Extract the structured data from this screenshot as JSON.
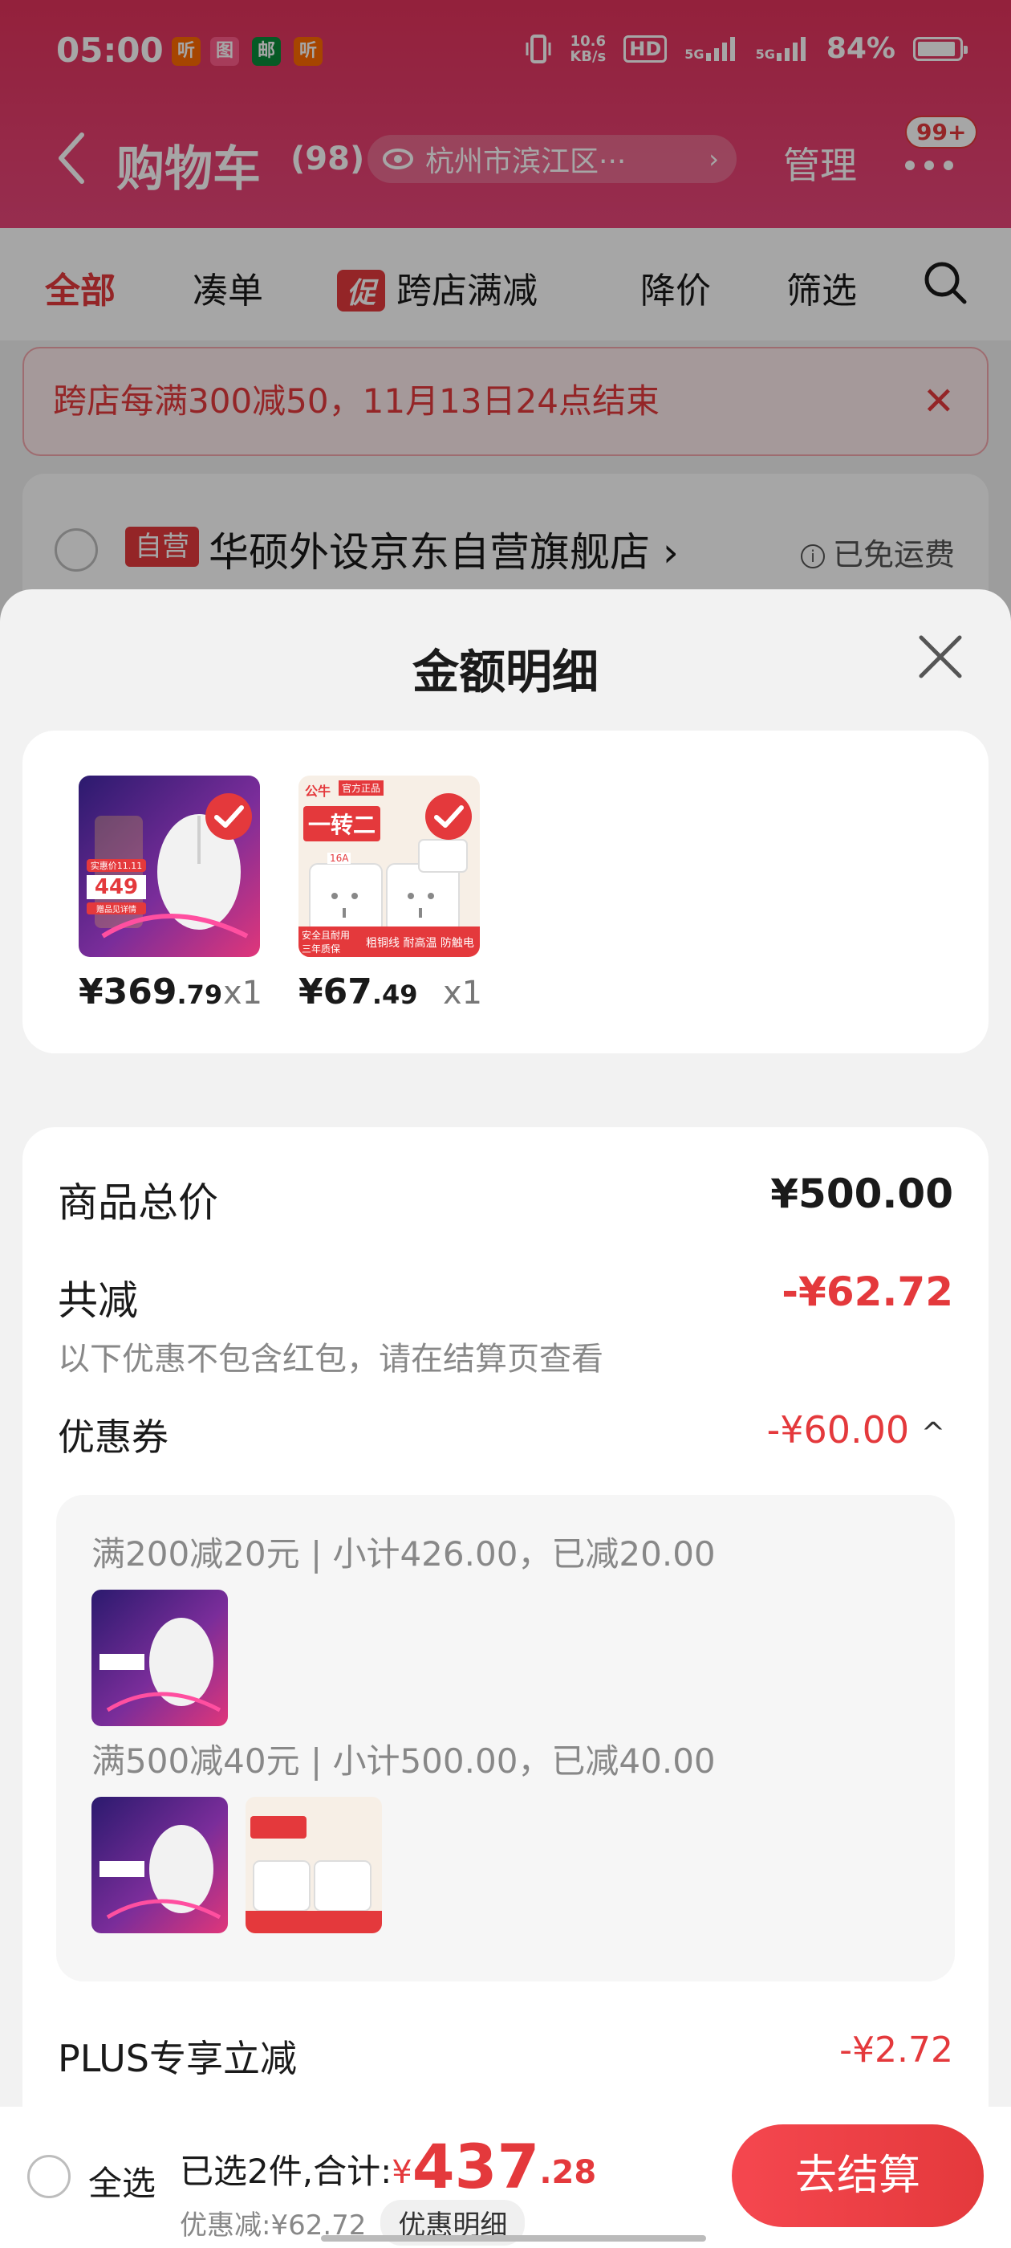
{
  "status_bar": {
    "time": "05:00",
    "apps": [
      {
        "icon": "listen-app-icon",
        "label": "听",
        "color": "#ff6a00"
      },
      {
        "icon": "map-app-icon",
        "label": "图",
        "color": "#ff5c8a"
      },
      {
        "icon": "post-app-icon",
        "label": "邮",
        "color": "#0a8a3a"
      },
      {
        "icon": "listen-app-icon-2",
        "label": "听",
        "color": "#ff6a00"
      }
    ],
    "net_speed_top": "10.6",
    "net_speed_bottom": "KB/s",
    "hd_label": "HD",
    "sig1": "5G",
    "sig2": "5G",
    "battery": "84%"
  },
  "nav": {
    "title": "购物车",
    "count": "(98)",
    "location": "杭州市滨江区···",
    "manage": "管理",
    "badge": "99+"
  },
  "filters": {
    "all": "全部",
    "bundle": "凑单",
    "promo_chip": "促",
    "cross_store": "跨店满减",
    "price_drop": "降价",
    "filter": "筛选"
  },
  "notice": {
    "text": "跨店每满300减50，11月13日24点结束",
    "close": "✕"
  },
  "store": {
    "self_tag": "自营",
    "name": "华硕外设京东自营旗舰店",
    "chevron": "›",
    "info_icon": "i",
    "shipping": "已免运费"
  },
  "sheet": {
    "title": "金额明细",
    "products": [
      {
        "price_int": "¥369",
        "price_dec": ".79",
        "qty": "x1",
        "image": "rog-mouse-image"
      },
      {
        "price_int": "¥67",
        "price_dec": ".49",
        "qty": "x1",
        "image": "bull-socket-image"
      }
    ],
    "mouse_img_text": {
      "line1": "实惠价11.11",
      "price": "449",
      "line3": "赠品见详情"
    },
    "socket_img_text": {
      "brand": "公牛",
      "official": "官方正品",
      "big": "一转二",
      "label": "16A",
      "footer1": "安全且耐用",
      "footer2": "三年质保",
      "footer3": "粗铜线 耐高温 防触电"
    },
    "total_label": "商品总价",
    "total_value": "¥500.00",
    "reduce_label": "共减",
    "reduce_value": "-¥62.72",
    "reduce_note": "以下优惠不包含红包，请在结算页查看",
    "coupon_label": "优惠券",
    "coupon_value": "-¥60.00",
    "coupon_chevron": "^",
    "coupon_lines": [
      "满200减20元 | 小计426.00，已减20.00",
      "满500减40元 | 小计500.00，已减40.00"
    ],
    "plus_label": "PLUS专享立减",
    "plus_value": "-¥2.72"
  },
  "bottom": {
    "select_all": "全选",
    "selected_prefix": "已选2件,合计:",
    "total_currency": "¥",
    "total_int": "437",
    "total_dec": ".28",
    "discount_text": "优惠减:¥62.72",
    "detail_button": "优惠明细",
    "checkout": "去结算"
  },
  "colors": {
    "accent": "#e4393c",
    "header": "#e2335c"
  }
}
